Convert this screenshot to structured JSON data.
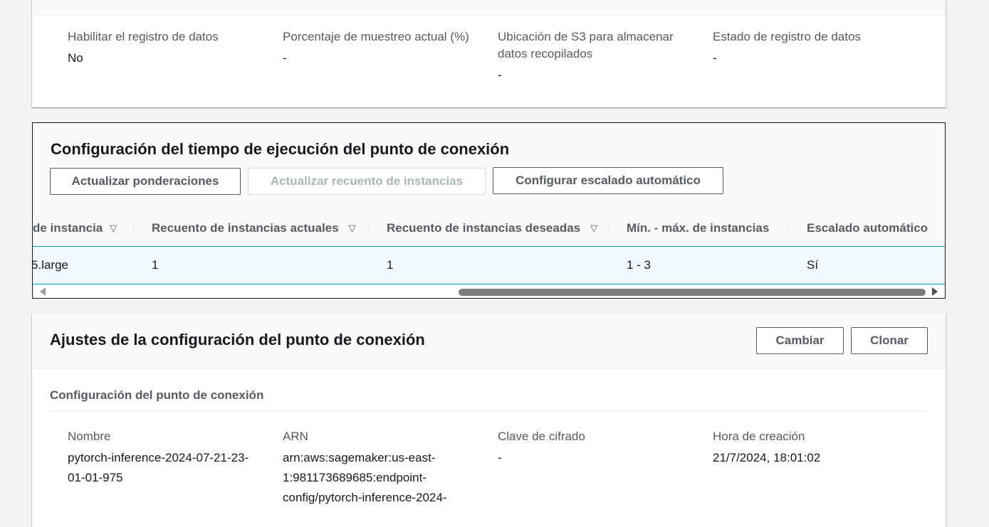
{
  "capture_panel": {
    "fields": [
      {
        "label": "Habilitar el registro de datos",
        "value": "No"
      },
      {
        "label": "Porcentaje de muestreo actual (%)",
        "value": "-"
      },
      {
        "label": "Ubicación de S3 para almacenar datos recopilados",
        "value": "-"
      },
      {
        "label": "Estado de registro de datos",
        "value": "-"
      }
    ]
  },
  "runtime_panel": {
    "title": "Configuración del tiempo de ejecución del punto de conexión",
    "buttons": {
      "update_weights": "Actualizar ponderaciones",
      "update_instance_count": "Actualizar recuento de instancias",
      "configure_autoscaling": "Configurar escalado automático"
    },
    "table": {
      "headers": [
        "de instancia",
        "Recuento de instancias actuales",
        "Recuento de instancias deseadas",
        "Mín. - máx. de instancias",
        "Escalado automático"
      ],
      "sort_icon": "▽",
      "row": [
        "5.large",
        "1",
        "1",
        "1 - 3",
        "Sí"
      ]
    }
  },
  "config_panel": {
    "title": "Ajustes de la configuración del punto de conexión",
    "buttons": {
      "change": "Cambiar",
      "clone": "Clonar"
    },
    "section_title": "Configuración del punto de conexión",
    "fields": [
      {
        "label": "Nombre",
        "value": "pytorch-inference-2024-07-21-23-01-01-975"
      },
      {
        "label": "ARN",
        "value": "arn:aws:sagemaker:us-east-1:981173689685:endpoint-config/pytorch-inference-2024-"
      },
      {
        "label": "Clave de cifrado",
        "value": "-"
      },
      {
        "label": "Hora de creación",
        "value": "21/7/2024, 18:01:02"
      }
    ]
  }
}
